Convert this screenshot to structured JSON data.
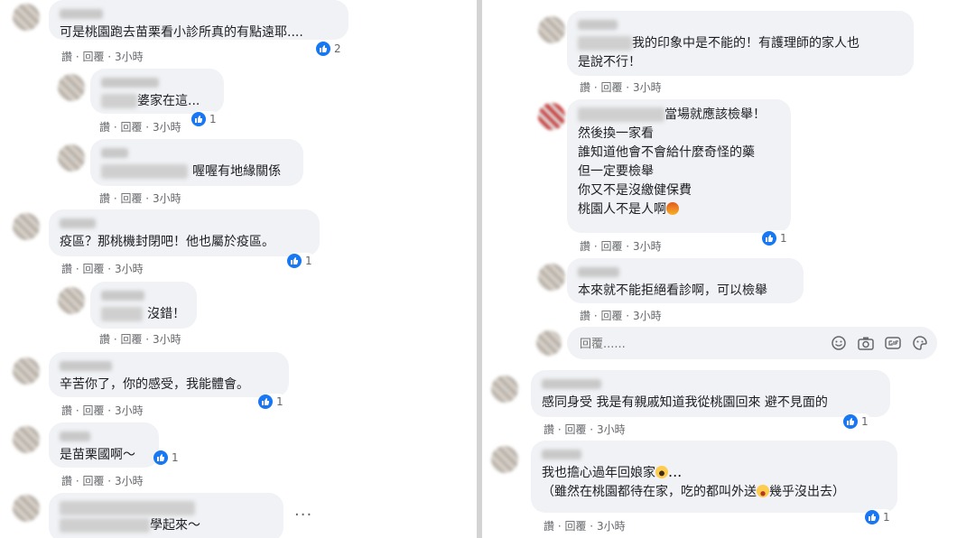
{
  "actions": {
    "like": "讚",
    "reply": "回覆",
    "sep": "·"
  },
  "left_comments": [
    {
      "text": "可是桃園跑去苗栗看小診所真的有點遠耶....",
      "time": "3小時",
      "reactions": "2"
    },
    {
      "text": "婆家在這...",
      "time": "3小時",
      "reactions": "1"
    },
    {
      "text": "喔喔有地緣關係",
      "time": "3小時",
      "reactions": ""
    },
    {
      "text": "疫區？那桃機封閉吧！他也屬於疫區。",
      "time": "3小時",
      "reactions": "1"
    },
    {
      "text": "沒錯！",
      "time": "3小時",
      "reactions": ""
    },
    {
      "text": "辛苦你了，你的感受，我能體會。",
      "time": "3小時",
      "reactions": "1"
    },
    {
      "text": "是苗栗國啊～",
      "time": "3小時",
      "reactions": "1"
    },
    {
      "text": "學起來～",
      "time": "",
      "reactions": ""
    }
  ],
  "right_comments": [
    {
      "text_lines": [
        "我的印象中是不能的！有護理師的家人也",
        "是說不行！"
      ],
      "time": "3小時",
      "reactions": ""
    },
    {
      "text_lines": [
        "當場就應該檢舉！",
        "然後換一家看",
        "誰知道他會不會給什麼奇怪的藥",
        "但一定要檢舉",
        "你又不是沒繳健保費",
        "桃園人不是人啊"
      ],
      "time": "3小時",
      "reactions": "1"
    },
    {
      "text_lines": [
        "本來就不能拒絕看診啊，可以檢舉"
      ],
      "time": "3小時",
      "reactions": ""
    },
    {
      "text_lines": [
        "感同身受 我是有親戚知道我從桃園回來 避不見面的"
      ],
      "time": "3小時",
      "reactions": "1"
    },
    {
      "text_lines": [
        "我也擔心過年回娘家",
        "（雖然在桃園都待在家，吃的都叫外送",
        "幾乎沒出去）"
      ],
      "time": "3小時",
      "reactions": "1"
    }
  ],
  "reply_box": {
    "placeholder": "回覆......"
  },
  "icons": [
    "emoji-icon",
    "camera-icon",
    "gif-icon",
    "sticker-icon",
    "like-icon",
    "more-options-icon"
  ],
  "colors": {
    "like_blue": "#1877f2",
    "bubble": "#f0f2f5",
    "meta_gray": "#65676b"
  }
}
